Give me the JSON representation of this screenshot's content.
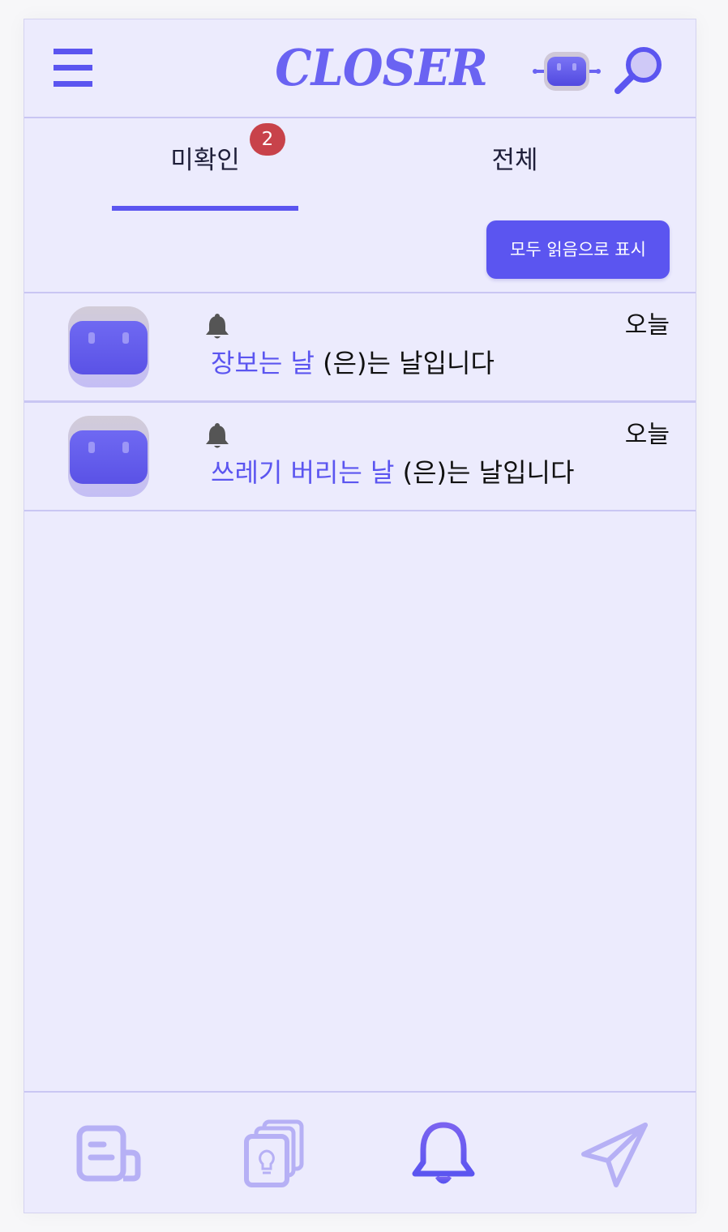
{
  "header": {
    "logo_text": "CLOSER",
    "menu_icon": "hamburger-menu-icon",
    "robot_icon": "robot-icon",
    "search_icon": "search-icon"
  },
  "tabs": [
    {
      "label": "미확인",
      "badge": "2",
      "active": true
    },
    {
      "label": "전체",
      "active": false
    }
  ],
  "actions": {
    "mark_all_read": "모두 읽음으로 표시"
  },
  "notifications": [
    {
      "event": "장보는 날",
      "suffix": " (은)는 날입니다",
      "date": "오늘",
      "icon": "bell-icon"
    },
    {
      "event": "쓰레기 버리는 날",
      "suffix": " (은)는 날입니다",
      "date": "오늘",
      "icon": "bell-icon"
    }
  ],
  "bottom_nav": [
    {
      "icon": "board-icon",
      "active": false
    },
    {
      "icon": "idea-cards-icon",
      "active": false
    },
    {
      "icon": "bell-icon",
      "active": true
    },
    {
      "icon": "paper-plane-icon",
      "active": false
    }
  ],
  "colors": {
    "accent": "#5b55f0",
    "background": "#ecebfd",
    "badge": "#c8424a",
    "divider": "#c9c6f3",
    "nav_inactive": "#b6b0f5"
  }
}
